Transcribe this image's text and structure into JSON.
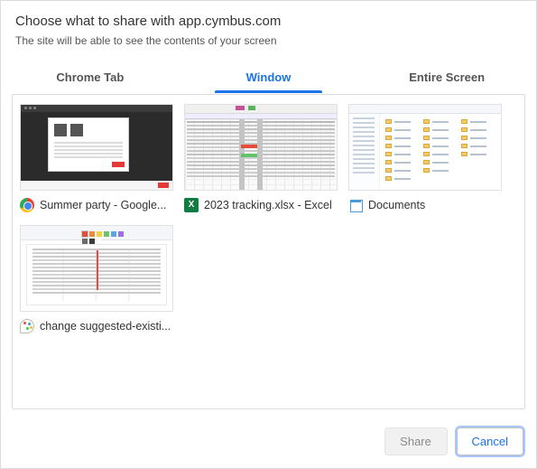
{
  "header": {
    "title": "Choose what to share with app.cymbus.com",
    "subtitle": "The site will be able to see the contents of your screen"
  },
  "tabs": [
    {
      "label": "Chrome Tab",
      "active": false
    },
    {
      "label": "Window",
      "active": true
    },
    {
      "label": "Entire Screen",
      "active": false
    }
  ],
  "windows": [
    {
      "label": "Summer party - Google...",
      "app": "chrome"
    },
    {
      "label": "2023 tracking.xlsx - Excel",
      "app": "excel"
    },
    {
      "label": "Documents",
      "app": "explorer"
    },
    {
      "label": "change suggested-existi...",
      "app": "paint"
    }
  ],
  "footer": {
    "share_label": "Share",
    "cancel_label": "Cancel"
  }
}
